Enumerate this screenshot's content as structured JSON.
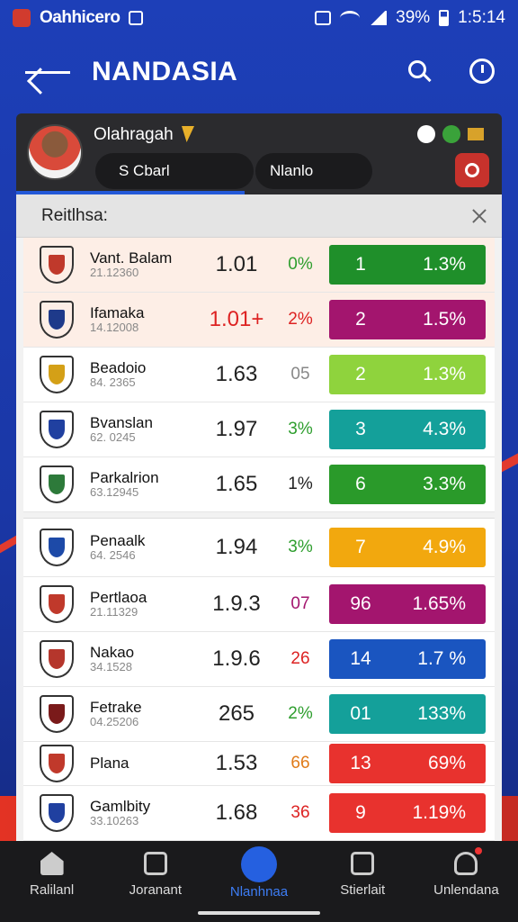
{
  "status_bar": {
    "app_name": "Oahhicero",
    "battery": "39%",
    "time": "1:5:14"
  },
  "app_bar": {
    "title": "NANDASIA"
  },
  "profile": {
    "name": "Olahragah",
    "tab_1": "S Cbarl",
    "tab_2": "Nlanlo",
    "progress": 0.47
  },
  "section": {
    "title": "Reitlhsa:"
  },
  "rows": [
    {
      "name": "Vant. Balam",
      "sub": "21.12360",
      "odd": "1.01",
      "pct": "0%",
      "rank": "1",
      "value": "1.3%",
      "bar_color": "#1f8f2a",
      "crest": "#c0392b",
      "odd_color": "#222",
      "pct_color": "#2e9e2e"
    },
    {
      "name": "Ifamaka",
      "sub": "14.12008",
      "odd": "1.01+",
      "pct": "2%",
      "rank": "2",
      "value": "1.5%",
      "bar_color": "#a3156e",
      "crest": "#1e3a8a",
      "odd_color": "#d22",
      "pct_color": "#d22"
    },
    {
      "name": "Beadoio",
      "sub": "84. 2365",
      "odd": "1.63",
      "pct": "05",
      "rank": "2",
      "value": "1.3%",
      "bar_color": "#8fd33d",
      "crest": "#d4a017",
      "odd_color": "#222",
      "pct_color": "#888"
    },
    {
      "name": "Bvanslan",
      "sub": "62. 0245",
      "odd": "1.97",
      "pct": "3%",
      "rank": "3",
      "value": "4.3%",
      "bar_color": "#14a09a",
      "crest": "#2040a0",
      "odd_color": "#222",
      "pct_color": "#2e9e2e"
    },
    {
      "name": "Parkalrion",
      "sub": "63.12945",
      "odd": "1.65",
      "pct": "1%",
      "rank": "6",
      "value": "3.3%",
      "bar_color": "#2a9a2a",
      "crest": "#2d7a3a",
      "odd_color": "#222",
      "pct_color": "#222"
    },
    {
      "name": "Penaalk",
      "sub": "64. 2546",
      "odd": "1.94",
      "pct": "3%",
      "rank": "7",
      "value": "4.9%",
      "bar_color": "#f2a80e",
      "crest": "#1d4aa8",
      "odd_color": "#222",
      "pct_color": "#2e9e2e"
    },
    {
      "name": "Pertlaoa",
      "sub": "21.11329",
      "odd": "1.9.3",
      "pct": "07",
      "rank": "96",
      "value": "1.65%",
      "bar_color": "#a3156e",
      "crest": "#c0392b",
      "odd_color": "#222",
      "pct_color": "#a3156e"
    },
    {
      "name": "Nakao",
      "sub": "34.1528",
      "odd": "1.9.6",
      "pct": "26",
      "rank": "14",
      "value": "1.7 %",
      "bar_color": "#1a55c0",
      "crest": "#b5362c",
      "odd_color": "#222",
      "pct_color": "#d22"
    },
    {
      "name": "Fetrake",
      "sub": "04.25206",
      "odd": "265",
      "pct": "2%",
      "rank": "01",
      "value": "133%",
      "bar_color": "#14a09a",
      "crest": "#7a1a1a",
      "odd_color": "#222",
      "pct_color": "#2e9e2e"
    },
    {
      "name": "Plana",
      "sub": "",
      "odd": "1.53",
      "pct": "66",
      "rank": "13",
      "value": "69%",
      "bar_color": "#e8322e",
      "crest": "#c0392b",
      "odd_color": "#222",
      "pct_color": "#e07b1a"
    },
    {
      "name": "Gamlbity",
      "sub": "33.10263",
      "odd": "1.68",
      "pct": "36",
      "rank": "9",
      "value": "1.19%",
      "bar_color": "#e8322e",
      "crest": "#2040a0",
      "odd_color": "#222",
      "pct_color": "#d22"
    }
  ],
  "nav": [
    {
      "label": "Ralilanl",
      "icon": "home-icon"
    },
    {
      "label": "Joranant",
      "icon": "document-icon"
    },
    {
      "label": "Nlanhnaa",
      "icon": "card-icon"
    },
    {
      "label": "Stierlait",
      "icon": "clipboard-icon"
    },
    {
      "label": "Unlendana",
      "icon": "bell-icon"
    }
  ]
}
